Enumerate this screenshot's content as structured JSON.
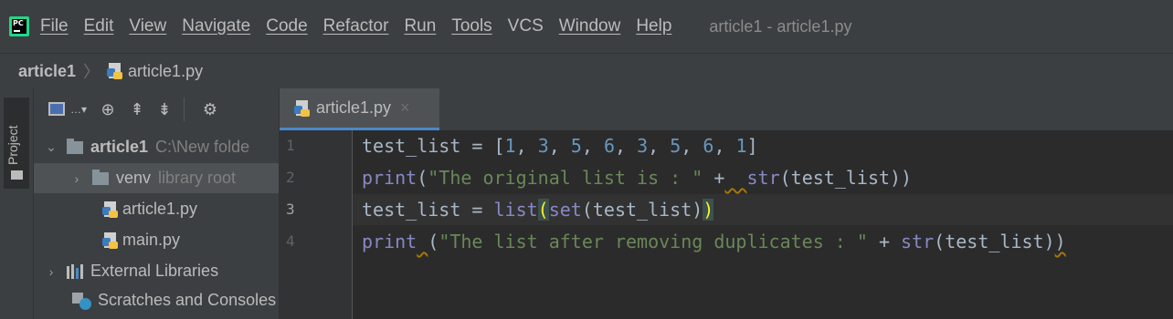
{
  "menubar": {
    "items": [
      "File",
      "Edit",
      "View",
      "Navigate",
      "Code",
      "Refactor",
      "Run",
      "Tools",
      "VCS",
      "Window",
      "Help"
    ],
    "title": "article1 - article1.py"
  },
  "breadcrumb": {
    "project": "article1",
    "separator": "〉",
    "file": "article1.py"
  },
  "toolstripe": {
    "project_label": "Project"
  },
  "project_panel": {
    "tree": [
      {
        "label": "article1",
        "hint": "C:\\New folde"
      },
      {
        "label": "venv",
        "hint": "library root"
      },
      {
        "label": "article1.py"
      },
      {
        "label": "main.py"
      },
      {
        "label": "External Libraries"
      },
      {
        "label": "Scratches and Consoles"
      }
    ]
  },
  "editor": {
    "tab_label": "article1.py",
    "tab_close": "×",
    "line_numbers": [
      "1",
      "2",
      "3",
      "4"
    ],
    "lines": [
      [
        {
          "t": "test_list = [",
          "c": ""
        },
        {
          "t": "1",
          "c": "n"
        },
        {
          "t": ", ",
          "c": ""
        },
        {
          "t": "3",
          "c": "n"
        },
        {
          "t": ", ",
          "c": ""
        },
        {
          "t": "5",
          "c": "n"
        },
        {
          "t": ", ",
          "c": ""
        },
        {
          "t": "6",
          "c": "n"
        },
        {
          "t": ", ",
          "c": ""
        },
        {
          "t": "3",
          "c": "n"
        },
        {
          "t": ", ",
          "c": ""
        },
        {
          "t": "5",
          "c": "n"
        },
        {
          "t": ", ",
          "c": ""
        },
        {
          "t": "6",
          "c": "n"
        },
        {
          "t": ", ",
          "c": ""
        },
        {
          "t": "1",
          "c": "n"
        },
        {
          "t": "]",
          "c": ""
        }
      ],
      [
        {
          "t": "print",
          "c": "b"
        },
        {
          "t": "(",
          "c": ""
        },
        {
          "t": "\"The original list is : \"",
          "c": "s"
        },
        {
          "t": " +",
          "c": ""
        },
        {
          "t": "  ",
          "c": "squig"
        },
        {
          "t": "str",
          "c": "b"
        },
        {
          "t": "(test_list))",
          "c": ""
        }
      ],
      [
        {
          "t": "test_list = ",
          "c": ""
        },
        {
          "t": "list",
          "c": "b"
        },
        {
          "t": "(",
          "c": "m"
        },
        {
          "t": "set",
          "c": "b"
        },
        {
          "t": "(test_list)",
          "c": ""
        },
        {
          "t": ")",
          "c": "m"
        }
      ],
      [
        {
          "t": "print",
          "c": "b"
        },
        {
          "t": " ",
          "c": "squig"
        },
        {
          "t": "(",
          "c": ""
        },
        {
          "t": "\"The list after removing duplicates : \"",
          "c": "s"
        },
        {
          "t": " + ",
          "c": ""
        },
        {
          "t": "str",
          "c": "b"
        },
        {
          "t": "(test_list)",
          "c": ""
        },
        {
          "t": ")",
          "c": "squig"
        }
      ]
    ]
  }
}
